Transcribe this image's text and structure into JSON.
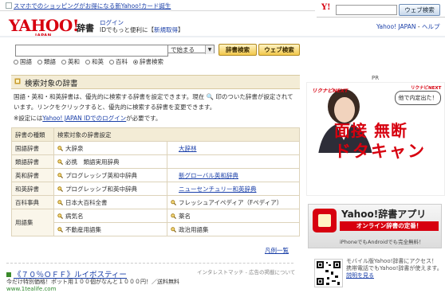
{
  "top_strip": {
    "link": "スマホでのショッピングがお得になる新Yahoo!カード誕生"
  },
  "side_search": {
    "logo": "Y!",
    "button": "ウェブ検索"
  },
  "header": {
    "logo": "YAHOO!",
    "logo_sub": "JAPAN",
    "service": "辞書",
    "login_link": "ログイン",
    "login_text_prefix": "IDでもっと便利に",
    "register_link": "新規取得",
    "yj_link": "Yahoo! JAPAN",
    "help_link": "ヘルプ"
  },
  "search": {
    "query": "",
    "match_select": "で始まる",
    "dict_button": "辞書検索",
    "web_button": "ウェブ検索",
    "radios": [
      {
        "label": "国語",
        "checked": false
      },
      {
        "label": "類語",
        "checked": false
      },
      {
        "label": "英和",
        "checked": false
      },
      {
        "label": "和英",
        "checked": false
      },
      {
        "label": "百科",
        "checked": false
      },
      {
        "label": "辞書検索",
        "checked": true
      }
    ]
  },
  "section": {
    "title": "検索対象の辞書",
    "desc": "国語・英和・和英辞書は、優先的に検索する辞書を設定できます。現在 🔍 印のついた辞書が設定されています。リンクをクリックすると、優先的に検索する辞書を変更できます。",
    "note_prefix": "※設定には",
    "note_link": "Yahoo! JAPAN IDでのログイン",
    "note_suffix": "が必要です。"
  },
  "table": {
    "headers": [
      "辞書の種類",
      "検索対象の辞書設定"
    ],
    "rows": [
      {
        "cat": "国語辞書",
        "a": "大辞泉",
        "a_icon": true,
        "b": "大辞林",
        "b_link": true,
        "b_icon": false
      },
      {
        "cat": "類語辞書",
        "a": "必携　類語実用辞典",
        "a_icon": true,
        "b": "",
        "b_link": false,
        "b_icon": false
      },
      {
        "cat": "英和辞書",
        "a": "プログレッシブ英和中辞典",
        "a_icon": true,
        "b": "新グローバル英和辞典",
        "b_link": true,
        "b_icon": false
      },
      {
        "cat": "和英辞書",
        "a": "プログレッシブ和英中辞典",
        "a_icon": true,
        "b": "ニューセンチュリー和英辞典",
        "b_link": true,
        "b_icon": false
      },
      {
        "cat": "百科事典",
        "a": "日本大百科全書",
        "a_icon": true,
        "b": "フレッシュアイペディア（Fペディア）",
        "b_link": false,
        "b_icon": true
      },
      {
        "cat": "用語集",
        "a": "病気名",
        "a_icon": true,
        "b": "薬名",
        "b_link": false,
        "b_icon": true
      },
      {
        "cat": "",
        "a": "不動産用語集",
        "a_icon": true,
        "b": "政治用語集",
        "b_link": false,
        "b_icon": true
      }
    ],
    "more_link": "凡例一覧"
  },
  "ad": {
    "title": "《７０％ＯＦＦ》ルイボスティー",
    "desc": "今だけ特別価格！ポット用１００個がなんと１０００円！／送料無料",
    "url": "www.1tealife.com",
    "right": "インタレストマッチ - 広告の掲載について"
  },
  "pr_label": "PR",
  "banner1": {
    "brand": "リクナビNEXT",
    "brand2": "リクナビNEXT",
    "tagline": "他で内定出た！",
    "line1": "面接 無断",
    "line2": "ドタキャン"
  },
  "banner2": {
    "title": "Yahoo!辞書アプリ",
    "ribbon": "オンライン辞書の定番！",
    "sub": "iPhoneでもAndroidでも完全無料！"
  },
  "bottom_ad": {
    "text": "モバイル版Yahoo!辞書にアクセス！ 携帯電話でもYahoo!辞書が使えます。",
    "link": "説明を見る"
  },
  "colors": {
    "brand_red": "#d7000f",
    "link_blue": "#1a3fa8",
    "table_bg": "#f3ecd6"
  }
}
